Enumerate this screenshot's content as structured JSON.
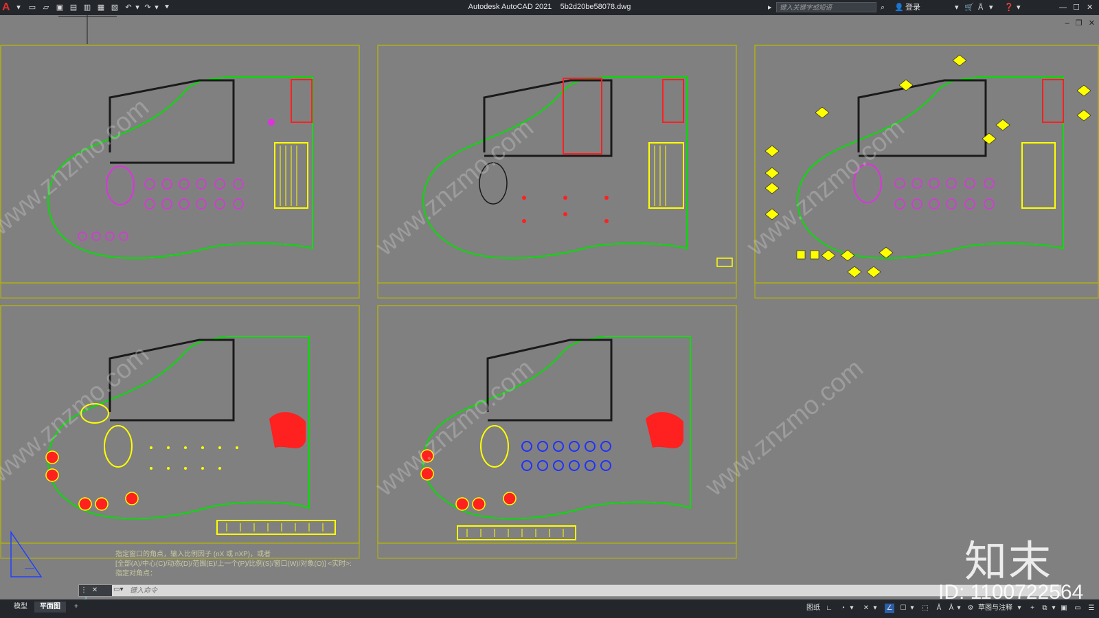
{
  "app": {
    "title": "Autodesk AutoCAD 2021",
    "file": "5b2d20be58078.dwg",
    "logo": "A"
  },
  "titlebar": {
    "search_placeholder": "键入关键字或短语",
    "signin": "登录",
    "icons": [
      "new-icon",
      "open-icon",
      "save-icon",
      "save-as-icon",
      "publish-icon",
      "plot-icon",
      "print-icon",
      "undo-icon",
      "redo-icon",
      "customize-icon",
      "search-icon",
      "user-icon",
      "cart-icon",
      "a360-icon",
      "help-icon"
    ]
  },
  "command": {
    "history": [
      "指定窗口的角点，输入比例因子 (nX 或 nXP)，或者",
      "[全部(A)/中心(C)/动态(D)/范围(E)/上一个(P)/比例(S)/窗口(W)/对象(O)] <实时>:",
      "指定对角点："
    ],
    "placeholder": "键入命令"
  },
  "layout_tabs": [
    "模型",
    "平面图",
    "+"
  ],
  "active_tab": "平面图",
  "status": {
    "paper": "图纸",
    "workspace": "草图与注释"
  },
  "watermark": {
    "site": "www.znzmo.com",
    "brand": "知末",
    "id": "ID: 1100722564"
  },
  "colors": {
    "background": "#808080",
    "titlebar": "#23262b",
    "frame": "#b8b800",
    "green": "#00e000",
    "magenta": "#e030e0",
    "yellow": "#ffff00",
    "red": "#ff2020",
    "blue": "#2030ff",
    "wall": "#1a1a1a"
  }
}
